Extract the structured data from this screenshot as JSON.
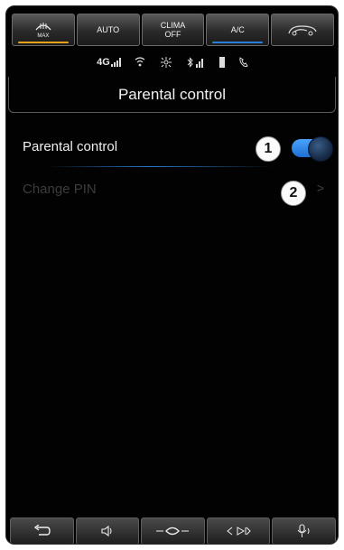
{
  "climate_bar": {
    "buttons": [
      {
        "label": "",
        "sub": "MAX",
        "icon": "defrost-icon",
        "indicator": "#e8a21a"
      },
      {
        "label": "AUTO"
      },
      {
        "label": "CLIMA",
        "sub": "OFF"
      },
      {
        "label": "A/C",
        "indicator": "#2a7fd6"
      },
      {
        "label": "",
        "icon": "recirculation-icon"
      }
    ]
  },
  "status_bar": {
    "network": "4G",
    "icons": [
      "4g-signal-icon",
      "wifi-icon",
      "fan-icon",
      "bluetooth-signal-icon",
      "battery-icon",
      "phone-icon"
    ]
  },
  "header": {
    "title": "Parental control"
  },
  "settings": {
    "items": [
      {
        "label": "Parental control",
        "control": "toggle",
        "state": "on"
      },
      {
        "label": "Change PIN",
        "control": "chevron",
        "enabled": false
      }
    ]
  },
  "callouts": [
    "1",
    "2"
  ],
  "bottom_bar": {
    "icons": [
      "back-icon",
      "volume-icon",
      "nav-icon",
      "media-icon",
      "voice-icon"
    ]
  },
  "colors": {
    "accent": "#2a7fd6",
    "max_indicator": "#e8a21a",
    "background": "#020202"
  }
}
